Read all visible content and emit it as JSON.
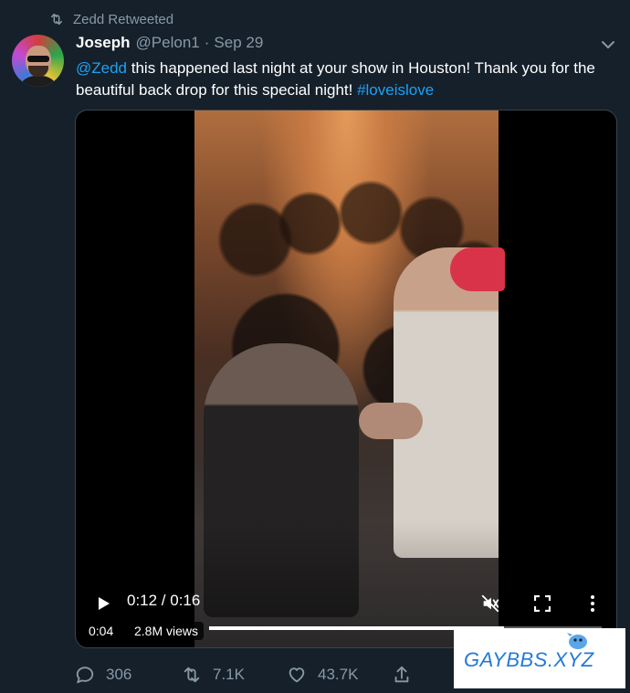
{
  "retweet_context": {
    "label": "Zedd Retweeted",
    "icon": "retweet-icon"
  },
  "tweet": {
    "author_name": "Joseph",
    "author_handle": "@Pelon1",
    "separator": "·",
    "date": "Sep 29",
    "text": {
      "mention": "@Zedd",
      "body": " this happened last night at your show in Houston! Thank you for the beautiful back drop for this special night! ",
      "hashtag": "#loveislove"
    }
  },
  "video": {
    "time_display": "0:12 / 0:16",
    "timestamp_badge": "0:04",
    "views": "2.8M views",
    "progress": 0.75,
    "muted": true
  },
  "actions": {
    "reply_count": "306",
    "retweet_count": "7.1K",
    "like_count": "43.7K"
  },
  "watermark": {
    "text": "GAYBBS.XYZ"
  },
  "colors": {
    "background": "#15202b",
    "secondary_text": "#8899a6",
    "link": "#1da1f2",
    "border": "#38444d",
    "watermark_text": "#2479d6"
  }
}
